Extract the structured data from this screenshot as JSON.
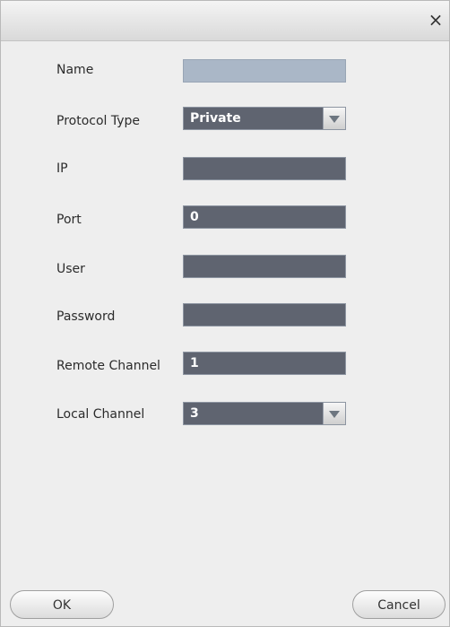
{
  "dialog": {
    "close_symbol": "×"
  },
  "form": {
    "name": {
      "label": "Name",
      "value": ""
    },
    "protocol_type": {
      "label": "Protocol Type",
      "value": "Private"
    },
    "ip": {
      "label": "IP",
      "value": ""
    },
    "port": {
      "label": "Port",
      "value": "0"
    },
    "user": {
      "label": "User",
      "value": ""
    },
    "password": {
      "label": "Password",
      "value": ""
    },
    "remote_channel": {
      "label": "Remote Channel",
      "value": "1"
    },
    "local_channel": {
      "label": "Local Channel",
      "value": "3"
    }
  },
  "buttons": {
    "ok": "OK",
    "cancel": "Cancel"
  }
}
